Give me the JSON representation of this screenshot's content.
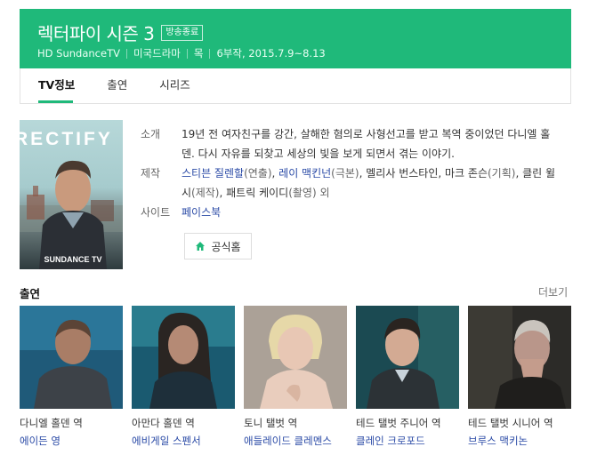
{
  "header": {
    "title": "렉터파이 시즌 3",
    "badge": "방송종료",
    "meta": [
      "HD SundanceTV",
      "미국드라마",
      "목",
      "6부작, 2015.7.9~8.13"
    ],
    "bg_color": "#1fb97a"
  },
  "tabs": [
    "TV정보",
    "출연",
    "시리즈"
  ],
  "poster": {
    "title_text": "RECTIFY",
    "brand_text": "SUNDANCE TV"
  },
  "info": {
    "summary_label": "소개",
    "summary": "19년 전 여자친구를 강간, 살해한 혐의로 사형선고를 받고 복역 중이었던 다니엘 홀덴. 다시 자유를 되찾고 세상의 빛을 보게 되면서 겪는 이야기.",
    "production_label": "제작",
    "production": [
      {
        "name": "스티븐 질렌할",
        "role": "(연출)"
      },
      {
        "name": "레이 맥킨넌",
        "role": "(극본)"
      },
      {
        "name": "멜리사 번스타인",
        "role": ""
      },
      {
        "name": "마크 존슨",
        "role": "(기획)"
      },
      {
        "name": "클린 윌시",
        "role": "(제작)"
      },
      {
        "name": "패트릭 케이디",
        "role": "(촬영) 외"
      }
    ],
    "site_label": "사이트",
    "site": "페이스북",
    "homepage_button": "공식홈"
  },
  "cast": {
    "title": "출연",
    "more": "더보기",
    "members": [
      {
        "role": "다니엘 홀덴 역",
        "actor": "에이든 영"
      },
      {
        "role": "아만다 홀덴 역",
        "actor": "에비게일 스펜서"
      },
      {
        "role": "토니 탤벗 역",
        "actor": "애들레이드 클레멘스"
      },
      {
        "role": "테드 탤벗 주니어 역",
        "actor": "클레인 크로포드"
      },
      {
        "role": "테드 탤벗 시니어 역",
        "actor": "브루스 맥키논"
      }
    ]
  }
}
